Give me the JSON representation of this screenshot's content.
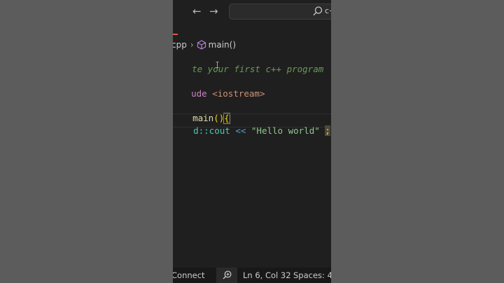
{
  "nav": {
    "back_icon": "arrow-left-icon",
    "forward_icon": "arrow-right-icon"
  },
  "search": {
    "icon": "search-icon",
    "text": "c+"
  },
  "breadcrumb": {
    "file": "cpp",
    "symbol_icon": "cube-icon",
    "symbol": "main()"
  },
  "code": {
    "line1_comment": "te your first c++ program",
    "line3_keyword": "ude",
    "line3_header": " <iostream>",
    "line5_fn": "main",
    "line5_parens": "()",
    "line5_brace": "{",
    "line6_ns": "d::cout",
    "line6_op": " << ",
    "line6_string": "\"Hello world\"",
    "line6_space": " ",
    "line6_semicolon": ";"
  },
  "status": {
    "connect": "Connect",
    "zoom_icon": "zoom-in-icon",
    "position": "Ln 6, Col 32",
    "spaces": "Spaces: 4"
  },
  "colors": {
    "editor_bg": "#1f1f1f",
    "comment": "#6a9955",
    "keyword": "#c586c0",
    "string": "#ce9178",
    "accent_red": "#f14c4c"
  }
}
